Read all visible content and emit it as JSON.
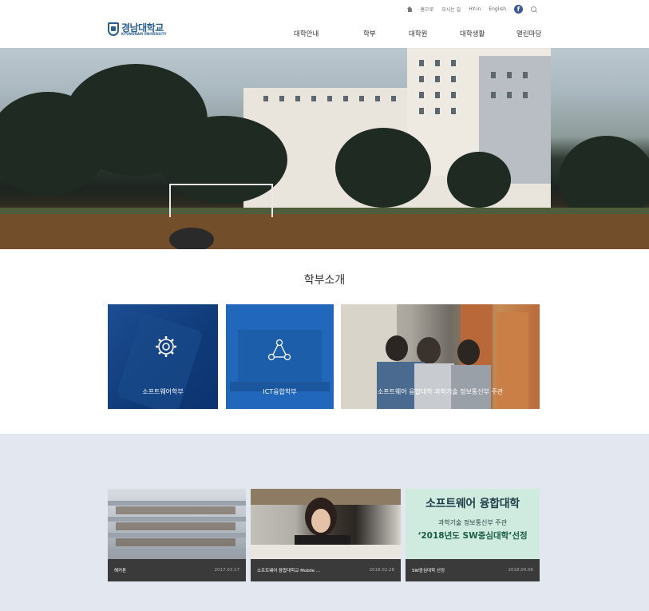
{
  "header": {
    "utility": [
      "홈으로",
      "오시는 길",
      "HY-in",
      "English"
    ],
    "logo": {
      "ko": "경남대학교",
      "en": "KYUNGNAM UNIVERSITY"
    },
    "nav": [
      "대학안내",
      "학부",
      "대학원",
      "대학생활",
      "열린마당"
    ]
  },
  "intro": {
    "title": "학부소개",
    "cards": [
      "소프트웨어학부",
      "ICT융합학부",
      "소프트웨어 융합대학 과학기술 정보통신부 주관"
    ]
  },
  "news": [
    {
      "title": "해커톤",
      "date": "2017.03.17"
    },
    {
      "title": "소프트웨어 융합대학교 Mobile ...",
      "date": "2018.02.28"
    },
    {
      "title": "SW중심대학 선정",
      "date": "2018.04.06"
    }
  ],
  "sw_banner": {
    "title": "소프트웨어 융합대학",
    "subtitle": "과학기술 정보통신부 주관",
    "selection": "‘2018년도 SW중심대학’선정"
  },
  "colors": {
    "brand": "#2b5f8f",
    "card1": "#0f3a78",
    "card2": "#2168bd",
    "bottom_bg": "#e3e7ef",
    "news_bar": "#3a3a3a"
  }
}
